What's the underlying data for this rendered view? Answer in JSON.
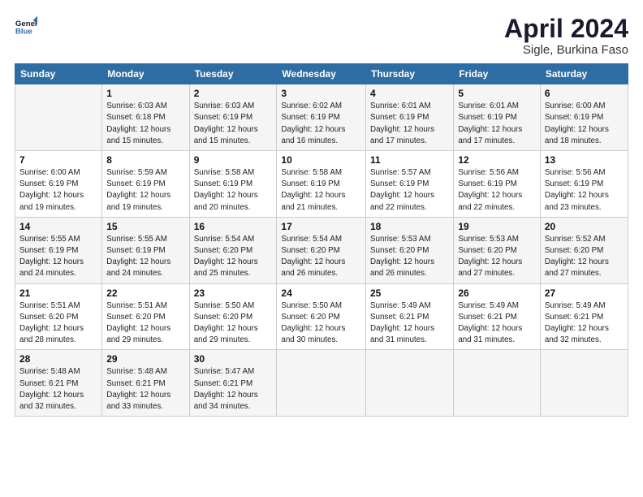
{
  "header": {
    "logo_line1": "General",
    "logo_line2": "Blue",
    "title": "April 2024",
    "subtitle": "Sigle, Burkina Faso"
  },
  "weekdays": [
    "Sunday",
    "Monday",
    "Tuesday",
    "Wednesday",
    "Thursday",
    "Friday",
    "Saturday"
  ],
  "weeks": [
    [
      {
        "day": "",
        "info": ""
      },
      {
        "day": "1",
        "info": "Sunrise: 6:03 AM\nSunset: 6:18 PM\nDaylight: 12 hours\nand 15 minutes."
      },
      {
        "day": "2",
        "info": "Sunrise: 6:03 AM\nSunset: 6:19 PM\nDaylight: 12 hours\nand 15 minutes."
      },
      {
        "day": "3",
        "info": "Sunrise: 6:02 AM\nSunset: 6:19 PM\nDaylight: 12 hours\nand 16 minutes."
      },
      {
        "day": "4",
        "info": "Sunrise: 6:01 AM\nSunset: 6:19 PM\nDaylight: 12 hours\nand 17 minutes."
      },
      {
        "day": "5",
        "info": "Sunrise: 6:01 AM\nSunset: 6:19 PM\nDaylight: 12 hours\nand 17 minutes."
      },
      {
        "day": "6",
        "info": "Sunrise: 6:00 AM\nSunset: 6:19 PM\nDaylight: 12 hours\nand 18 minutes."
      }
    ],
    [
      {
        "day": "7",
        "info": "Sunrise: 6:00 AM\nSunset: 6:19 PM\nDaylight: 12 hours\nand 19 minutes."
      },
      {
        "day": "8",
        "info": "Sunrise: 5:59 AM\nSunset: 6:19 PM\nDaylight: 12 hours\nand 19 minutes."
      },
      {
        "day": "9",
        "info": "Sunrise: 5:58 AM\nSunset: 6:19 PM\nDaylight: 12 hours\nand 20 minutes."
      },
      {
        "day": "10",
        "info": "Sunrise: 5:58 AM\nSunset: 6:19 PM\nDaylight: 12 hours\nand 21 minutes."
      },
      {
        "day": "11",
        "info": "Sunrise: 5:57 AM\nSunset: 6:19 PM\nDaylight: 12 hours\nand 22 minutes."
      },
      {
        "day": "12",
        "info": "Sunrise: 5:56 AM\nSunset: 6:19 PM\nDaylight: 12 hours\nand 22 minutes."
      },
      {
        "day": "13",
        "info": "Sunrise: 5:56 AM\nSunset: 6:19 PM\nDaylight: 12 hours\nand 23 minutes."
      }
    ],
    [
      {
        "day": "14",
        "info": "Sunrise: 5:55 AM\nSunset: 6:19 PM\nDaylight: 12 hours\nand 24 minutes."
      },
      {
        "day": "15",
        "info": "Sunrise: 5:55 AM\nSunset: 6:19 PM\nDaylight: 12 hours\nand 24 minutes."
      },
      {
        "day": "16",
        "info": "Sunrise: 5:54 AM\nSunset: 6:20 PM\nDaylight: 12 hours\nand 25 minutes."
      },
      {
        "day": "17",
        "info": "Sunrise: 5:54 AM\nSunset: 6:20 PM\nDaylight: 12 hours\nand 26 minutes."
      },
      {
        "day": "18",
        "info": "Sunrise: 5:53 AM\nSunset: 6:20 PM\nDaylight: 12 hours\nand 26 minutes."
      },
      {
        "day": "19",
        "info": "Sunrise: 5:53 AM\nSunset: 6:20 PM\nDaylight: 12 hours\nand 27 minutes."
      },
      {
        "day": "20",
        "info": "Sunrise: 5:52 AM\nSunset: 6:20 PM\nDaylight: 12 hours\nand 27 minutes."
      }
    ],
    [
      {
        "day": "21",
        "info": "Sunrise: 5:51 AM\nSunset: 6:20 PM\nDaylight: 12 hours\nand 28 minutes."
      },
      {
        "day": "22",
        "info": "Sunrise: 5:51 AM\nSunset: 6:20 PM\nDaylight: 12 hours\nand 29 minutes."
      },
      {
        "day": "23",
        "info": "Sunrise: 5:50 AM\nSunset: 6:20 PM\nDaylight: 12 hours\nand 29 minutes."
      },
      {
        "day": "24",
        "info": "Sunrise: 5:50 AM\nSunset: 6:20 PM\nDaylight: 12 hours\nand 30 minutes."
      },
      {
        "day": "25",
        "info": "Sunrise: 5:49 AM\nSunset: 6:21 PM\nDaylight: 12 hours\nand 31 minutes."
      },
      {
        "day": "26",
        "info": "Sunrise: 5:49 AM\nSunset: 6:21 PM\nDaylight: 12 hours\nand 31 minutes."
      },
      {
        "day": "27",
        "info": "Sunrise: 5:49 AM\nSunset: 6:21 PM\nDaylight: 12 hours\nand 32 minutes."
      }
    ],
    [
      {
        "day": "28",
        "info": "Sunrise: 5:48 AM\nSunset: 6:21 PM\nDaylight: 12 hours\nand 32 minutes."
      },
      {
        "day": "29",
        "info": "Sunrise: 5:48 AM\nSunset: 6:21 PM\nDaylight: 12 hours\nand 33 minutes."
      },
      {
        "day": "30",
        "info": "Sunrise: 5:47 AM\nSunset: 6:21 PM\nDaylight: 12 hours\nand 34 minutes."
      },
      {
        "day": "",
        "info": ""
      },
      {
        "day": "",
        "info": ""
      },
      {
        "day": "",
        "info": ""
      },
      {
        "day": "",
        "info": ""
      }
    ]
  ]
}
